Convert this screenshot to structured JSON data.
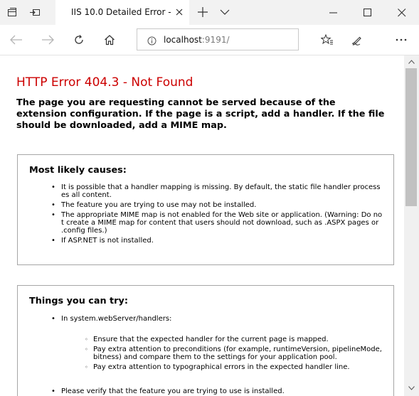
{
  "browser": {
    "tab_title": "IIS 10.0 Detailed Error -",
    "address_host": "localhost",
    "address_port": ":9191/"
  },
  "error": {
    "title": "HTTP Error 404.3 - Not Found",
    "message": "The page you are requesting cannot be served because of the extension configuration. If the page is a script, add a handler. If the file should be downloaded, add a MIME map."
  },
  "causes": {
    "title": "Most likely causes:",
    "items": [
      "It is possible that a handler mapping is missing. By default, the static file handler processes all content.",
      "The feature you are trying to use may not be installed.",
      "The appropriate MIME map is not enabled for the Web site or application. (Warning: Do not create a MIME map for content that users should not download, such as .ASPX pages or .config files.)",
      "If ASP.NET is not installed."
    ]
  },
  "try": {
    "title": "Things you can try:",
    "item1": "In system.webServer/handlers:",
    "sub_items": [
      "Ensure that the expected handler for the current page is mapped.",
      "Pay extra attention to preconditions (for example, runtimeVersion, pipelineMode, bitness) and compare them to the settings for your application pool.",
      "Pay extra attention to typographical errors in the expected handler line."
    ],
    "item2": "Please verify that the feature you are trying to use is installed."
  },
  "icons": {
    "tab_manager": "tab-manager-icon",
    "set_aside": "set-aside-tabs-icon",
    "close": "close-icon",
    "new_tab": "plus-icon",
    "tab_list": "chevron-down-icon",
    "minimize": "minimize-icon",
    "maximize": "maximize-icon",
    "back": "back-arrow-icon",
    "forward": "forward-arrow-icon",
    "refresh": "refresh-icon",
    "home": "home-icon",
    "info": "info-icon",
    "favorites": "favorites-star-icon",
    "notes": "pen-icon",
    "more": "more-icon"
  },
  "colors": {
    "error_title": "#cc0000",
    "titlebar": "#f2f2f2",
    "box_border": "#a6a6a6"
  }
}
